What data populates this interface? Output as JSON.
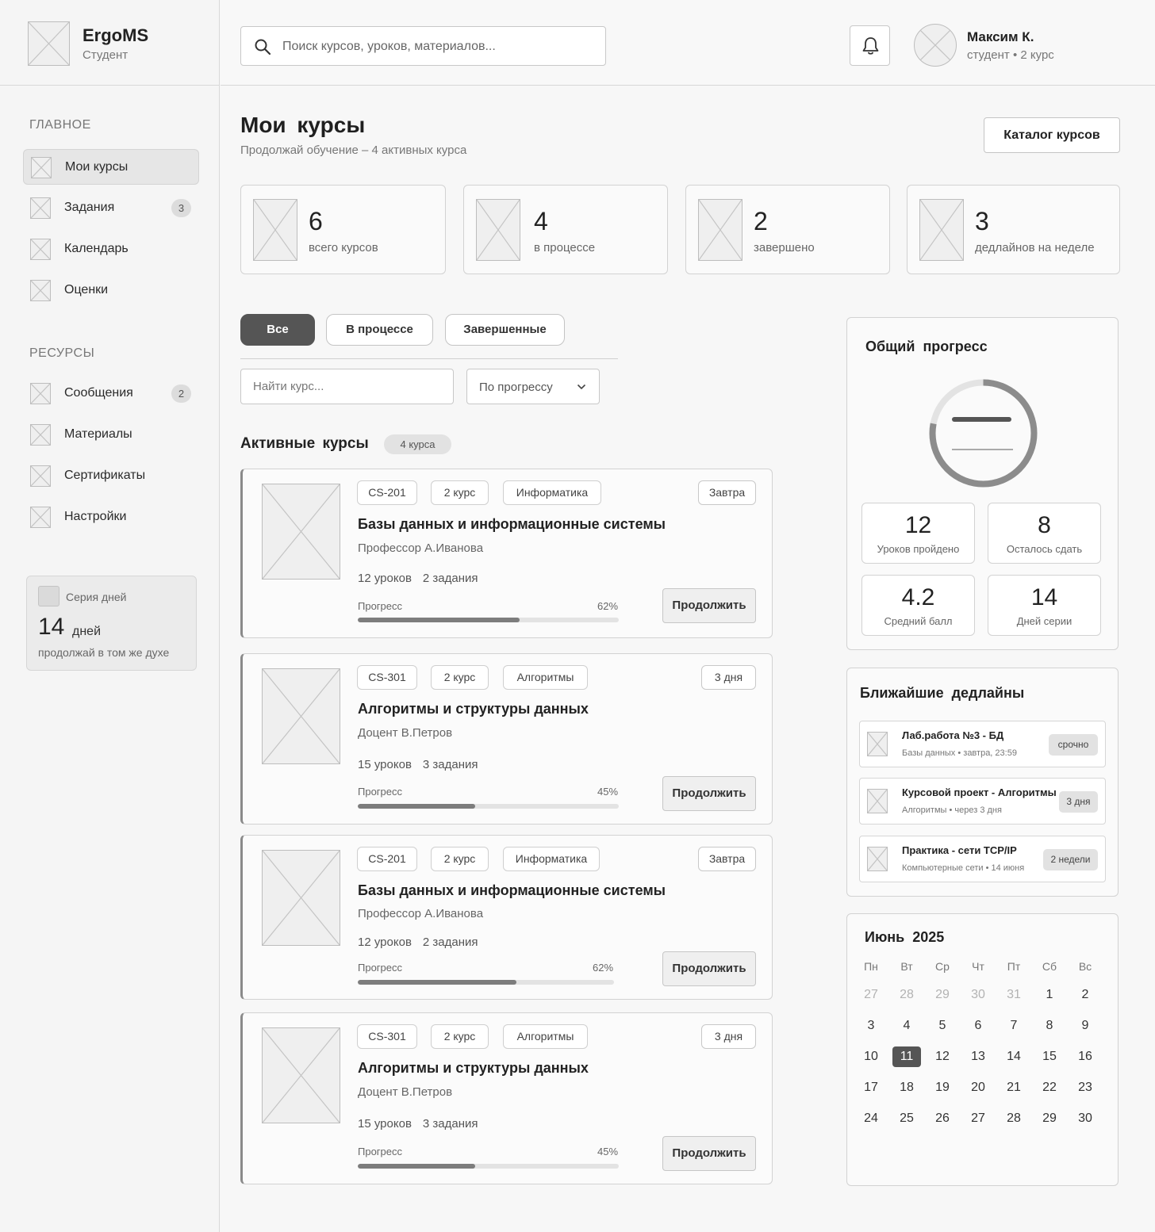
{
  "app": {
    "name": "ErgoMS",
    "role": "Студент"
  },
  "search": {
    "placeholder": "Поиск курсов, уроков, материалов..."
  },
  "user": {
    "name": "Максим К.",
    "meta": "студент  •  2 курс"
  },
  "sidebar": {
    "main_title": "ГЛАВНОЕ",
    "main_items": [
      {
        "label": "Мои курсы",
        "badge": ""
      },
      {
        "label": "Задания",
        "badge": "3"
      },
      {
        "label": "Календарь",
        "badge": ""
      },
      {
        "label": "Оценки",
        "badge": ""
      }
    ],
    "resources_title": "РЕСУРСЫ",
    "resource_items": [
      {
        "label": "Сообщения",
        "badge": "2"
      },
      {
        "label": "Материалы",
        "badge": ""
      },
      {
        "label": "Сертификаты",
        "badge": ""
      },
      {
        "label": "Настройки",
        "badge": ""
      }
    ],
    "streak": {
      "label": "Серия дней",
      "value": "14",
      "unit": "дней",
      "subtitle": "продолжай в том же духе"
    }
  },
  "page": {
    "title": "Мои курсы",
    "subtitle": "Продолжай обучение – 4 активных курса",
    "catalog_button": "Каталог курсов"
  },
  "stats": [
    {
      "value": "6",
      "label": "всего курсов"
    },
    {
      "value": "4",
      "label": "в процессе"
    },
    {
      "value": "2",
      "label": "завершено"
    },
    {
      "value": "3",
      "label": "дедлайнов на неделе"
    }
  ],
  "filters": {
    "tabs": [
      "Все",
      "В процессе",
      "Завершенные"
    ],
    "active": 0,
    "course_search_placeholder": "Найти курс...",
    "sort_label": "По прогрессу"
  },
  "active_courses": {
    "title": "Активные курсы",
    "badge": "4 курса",
    "progress_label": "Прогресс",
    "continue_label": "Продолжить",
    "courses": [
      {
        "code": "CS-201",
        "year": "2 курс",
        "subject": "Информатика",
        "deadline": "Завтра",
        "title": "Базы данных и информационные системы",
        "teacher": "Профессор А.Иванова",
        "lessons": "12 уроков",
        "tasks": "2 задания",
        "progress": 62,
        "progress_text": "62%"
      },
      {
        "code": "CS-301",
        "year": "2 курс",
        "subject": "Алгоритмы",
        "deadline": "3 дня",
        "title": "Алгоритмы и структуры данных",
        "teacher": "Доцент В.Петров",
        "lessons": "15 уроков",
        "tasks": "3 задания",
        "progress": 45,
        "progress_text": "45%"
      },
      {
        "code": "CS-201",
        "year": "2 курс",
        "subject": "Информатика",
        "deadline": "Завтра",
        "title": "Базы данных и информационные системы",
        "teacher": "Профессор А.Иванова",
        "lessons": "12 уроков",
        "tasks": "2 задания",
        "progress": 62,
        "progress_text": "62%"
      },
      {
        "code": "CS-301",
        "year": "2 курс",
        "subject": "Алгоритмы",
        "deadline": "3 дня",
        "title": "Алгоритмы и структуры данных",
        "teacher": "Доцент В.Петров",
        "lessons": "15 уроков",
        "tasks": "3 задания",
        "progress": 45,
        "progress_text": "45%"
      }
    ]
  },
  "overall": {
    "title": "Общий прогресс",
    "ring_progress": 0.78,
    "stats": [
      {
        "value": "12",
        "label": "Уроков пройдено"
      },
      {
        "value": "8",
        "label": "Осталось сдать"
      },
      {
        "value": "4.2",
        "label": "Средний балл"
      },
      {
        "value": "14",
        "label": "Дней серии"
      }
    ]
  },
  "deadlines": {
    "title": "Ближайшие дедлайны",
    "items": [
      {
        "title": "Лаб.работа №3 - БД",
        "subtitle": "Базы данных  •  завтра, 23:59",
        "badge": "срочно"
      },
      {
        "title": "Курсовой проект - Алгоритмы",
        "subtitle": "Алгоритмы  •  через 3 дня",
        "badge": "3 дня"
      },
      {
        "title": "Практика - сети TCP/IP",
        "subtitle": "Компьютерные сети  •  14 июня",
        "badge": "2 недели"
      }
    ]
  },
  "calendar": {
    "title": "Июнь 2025",
    "weekdays": [
      "Пн",
      "Вт",
      "Ср",
      "Чт",
      "Пт",
      "Сб",
      "Вс"
    ],
    "weeks": [
      [
        "27",
        "28",
        "29",
        "30",
        "31",
        "1",
        "2"
      ],
      [
        "3",
        "4",
        "5",
        "6",
        "7",
        "8",
        "9"
      ],
      [
        "10",
        "11",
        "12",
        "13",
        "14",
        "15",
        "16"
      ],
      [
        "17",
        "18",
        "19",
        "20",
        "21",
        "22",
        "23"
      ],
      [
        "24",
        "25",
        "26",
        "27",
        "28",
        "29",
        "30"
      ]
    ],
    "muted_first_row_count": 5,
    "today": "11"
  },
  "icons": {
    "search": "search-icon",
    "bell": "bell-icon",
    "chevron": "chevron-down-icon",
    "placeholder": "image-placeholder-icon"
  }
}
